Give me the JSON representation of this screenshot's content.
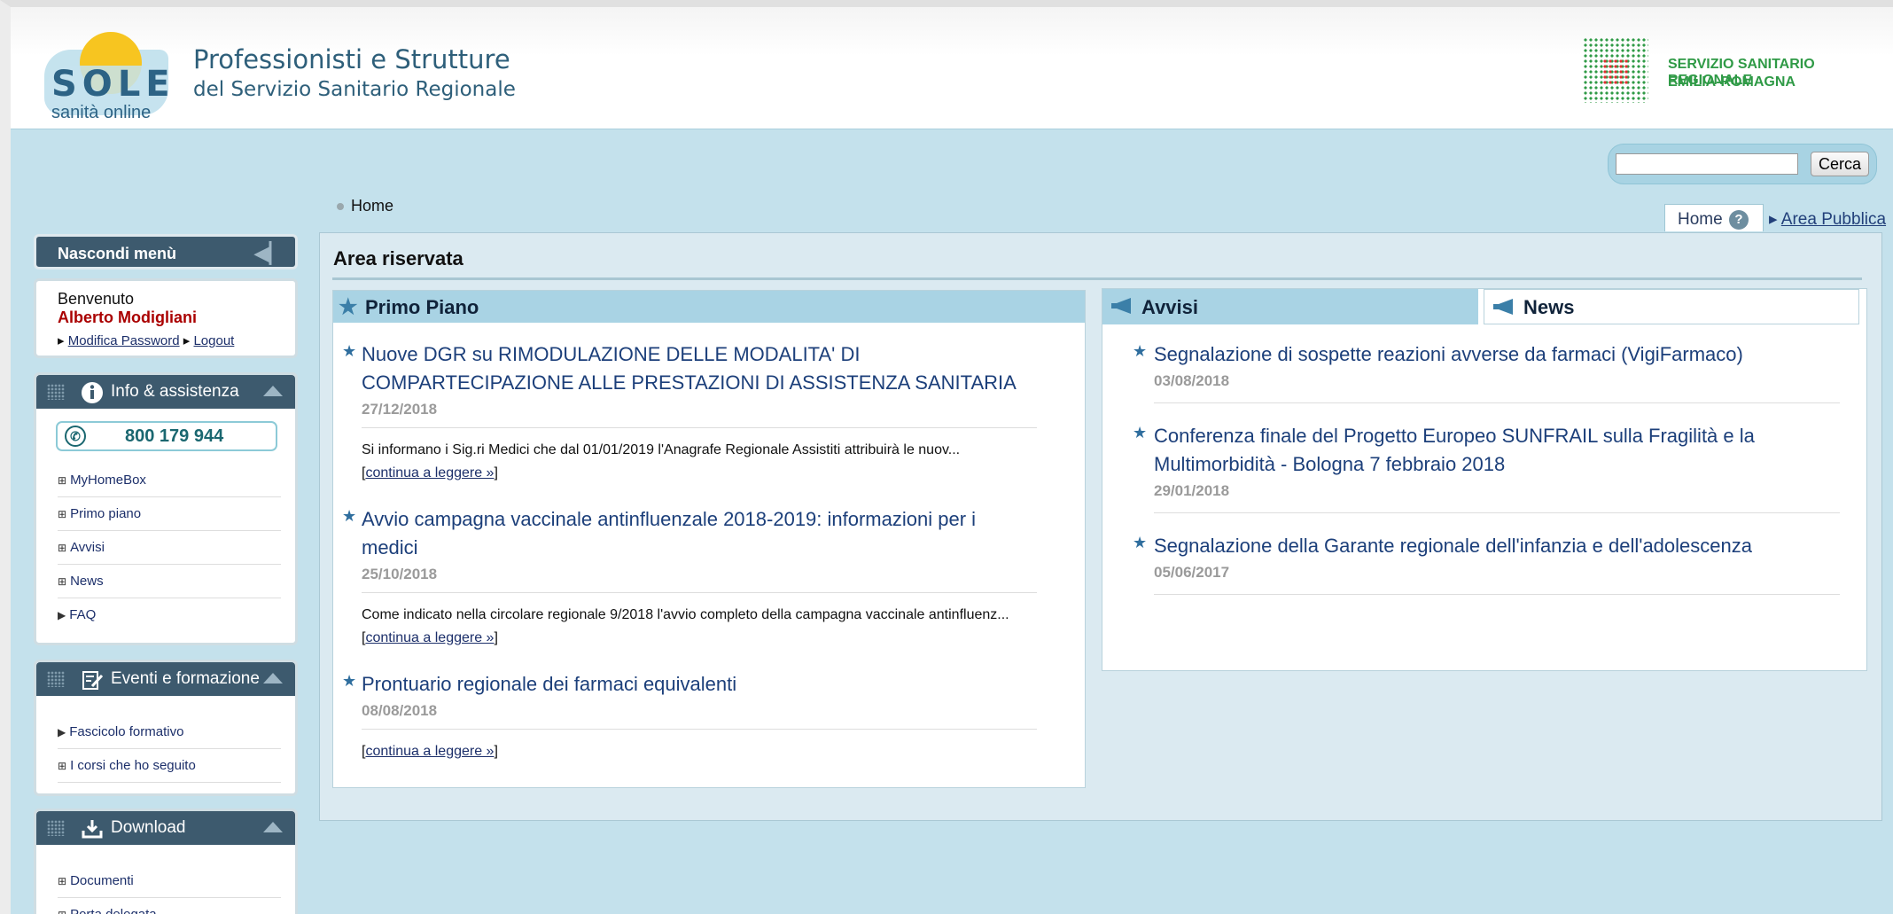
{
  "header": {
    "logo_sole": "SOLE",
    "logo_sub": "sanità online",
    "title_line1": "Professionisti e Strutture",
    "title_line2": "del Servizio Sanitario Regionale",
    "rer_line1": "SERVIZIO SANITARIO REGIONALE",
    "rer_line2": "EMILIA-ROMAGNA"
  },
  "search": {
    "value": "",
    "button_label": "Cerca"
  },
  "breadcrumb": {
    "label": "Home"
  },
  "topnav": {
    "home_tab": "Home",
    "help": "?",
    "area_pubblica": "Area Pubblica"
  },
  "sidebar": {
    "hide_menu": "Nascondi menù",
    "welcome": "Benvenuto",
    "user_name": "Alberto Modigliani",
    "change_password": "Modifica Password",
    "logout": "Logout",
    "info_title": "Info & assistenza",
    "phone": "800 179 944",
    "info_items": [
      "MyHomeBox",
      "Primo piano",
      "Avvisi",
      "News",
      "FAQ"
    ],
    "events_title": "Eventi e formazione",
    "events_items": [
      "Fascicolo formativo",
      "I corsi che ho seguito"
    ],
    "download_title": "Download",
    "download_items": [
      "Documenti",
      "Porta delegata"
    ]
  },
  "main": {
    "title": "Area riservata",
    "primo_piano": {
      "heading": "Primo Piano",
      "items": [
        {
          "title": "Nuove DGR su RIMODULAZIONE DELLE MODALITA' DI COMPARTECIPAZIONE ALLE PRESTAZIONI DI ASSISTENZA SANITARIA",
          "date": "27/12/2018",
          "excerpt": "Si informano i Sig.ri Medici che dal 01/01/2019 l'Anagrafe Regionale Assistiti attribuirà le nuov...",
          "link": "continua a leggere »"
        },
        {
          "title": "Avvio campagna vaccinale antinfluenzale 2018-2019: informazioni per i medici",
          "date": "25/10/2018",
          "excerpt": "Come indicato nella circolare regionale 9/2018 l'avvio completo della campagna vaccinale antinfluenz...",
          "link": "continua a leggere »"
        },
        {
          "title": "Prontuario regionale dei farmaci equivalenti",
          "date": "08/08/2018",
          "excerpt": "",
          "link": "continua a leggere »"
        }
      ]
    },
    "avvisi": {
      "tab_avvisi": "Avvisi",
      "tab_news": "News",
      "items": [
        {
          "title": "Segnalazione di sospette reazioni avverse da farmaci (VigiFarmaco)",
          "date": "03/08/2018"
        },
        {
          "title": "Conferenza finale del Progetto Europeo SUNFRAIL sulla Fragilità e la Multimorbidità - Bologna 7 febbraio 2018",
          "date": "29/01/2018"
        },
        {
          "title": "Segnalazione della Garante regionale dell'infanzia e dell'adolescenza",
          "date": "05/06/2017"
        }
      ]
    }
  }
}
